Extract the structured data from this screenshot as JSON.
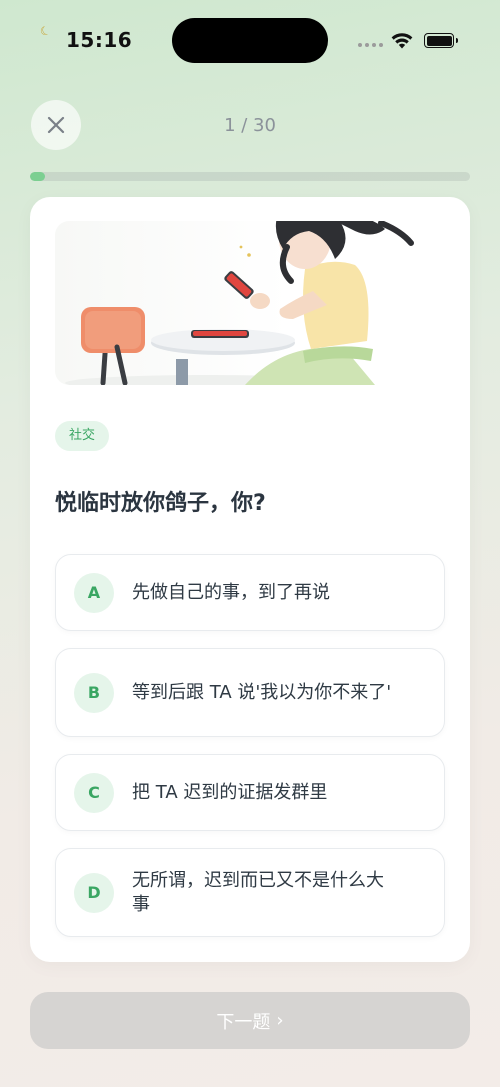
{
  "status_bar": {
    "time": "15:16"
  },
  "header": {
    "progress_text": "1 / 30",
    "progress_current": 1,
    "progress_total": 30
  },
  "question": {
    "category": "社交",
    "text": "悦临时放你鸽子，你?"
  },
  "options": [
    {
      "letter": "A",
      "text": "先做自己的事，到了再说"
    },
    {
      "letter": "B",
      "text": "等到后跟 TA 说'我以为你不来了'"
    },
    {
      "letter": "C",
      "text": "把 TA 迟到的证据发群里"
    },
    {
      "letter": "D",
      "text": "无所谓，迟到而已又不是什么大事"
    }
  ],
  "footer": {
    "next_label": "下一题"
  },
  "colors": {
    "accent": "#3aa663",
    "accent_bg": "#e5f5ea",
    "disabled_button": "#d6d4d2"
  }
}
